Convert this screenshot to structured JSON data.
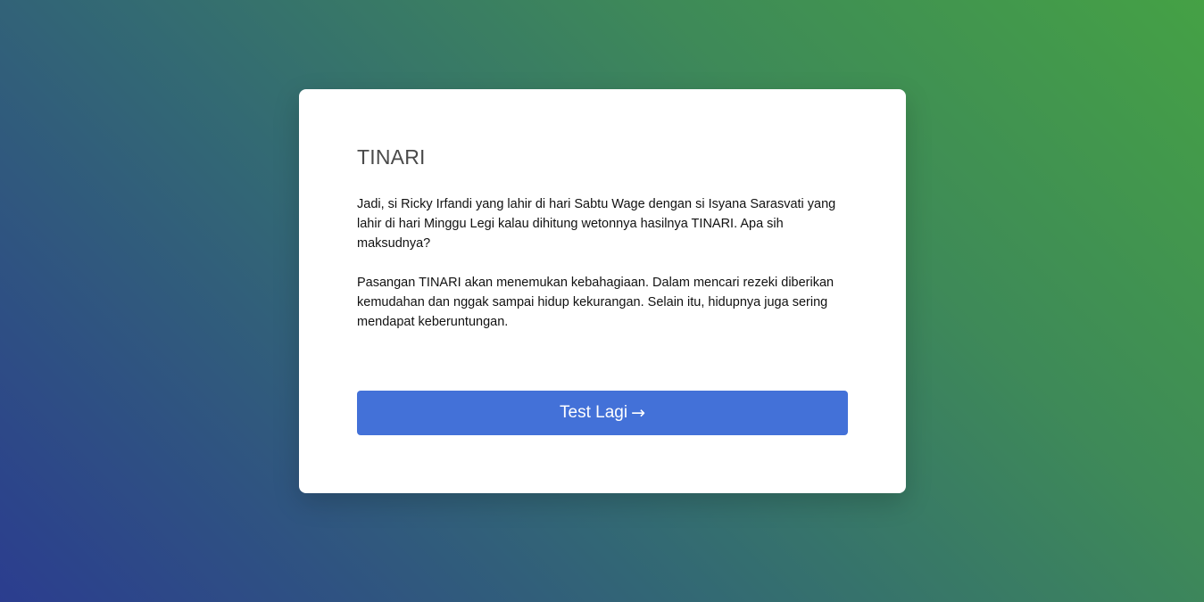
{
  "result": {
    "title": "TINARI",
    "paragraphs": [
      "Jadi, si Ricky Irfandi yang lahir di hari Sabtu Wage dengan si Isyana Sarasvati yang lahir di hari Minggu Legi kalau dihitung wetonnya hasilnya TINARI. Apa sih maksudnya?",
      "Pasangan TINARI akan menemukan kebahagiaan. Dalam mencari rezeki diberikan kemudahan dan nggak sampai hidup kekurangan. Selain itu, hidupnya juga sering mendapat keberuntungan."
    ],
    "button": {
      "label": "Test Lagi",
      "arrow": "→"
    }
  },
  "colors": {
    "button": "#4371d8",
    "gradient_start": "#2b3d8f",
    "gradient_end": "#45a145"
  }
}
